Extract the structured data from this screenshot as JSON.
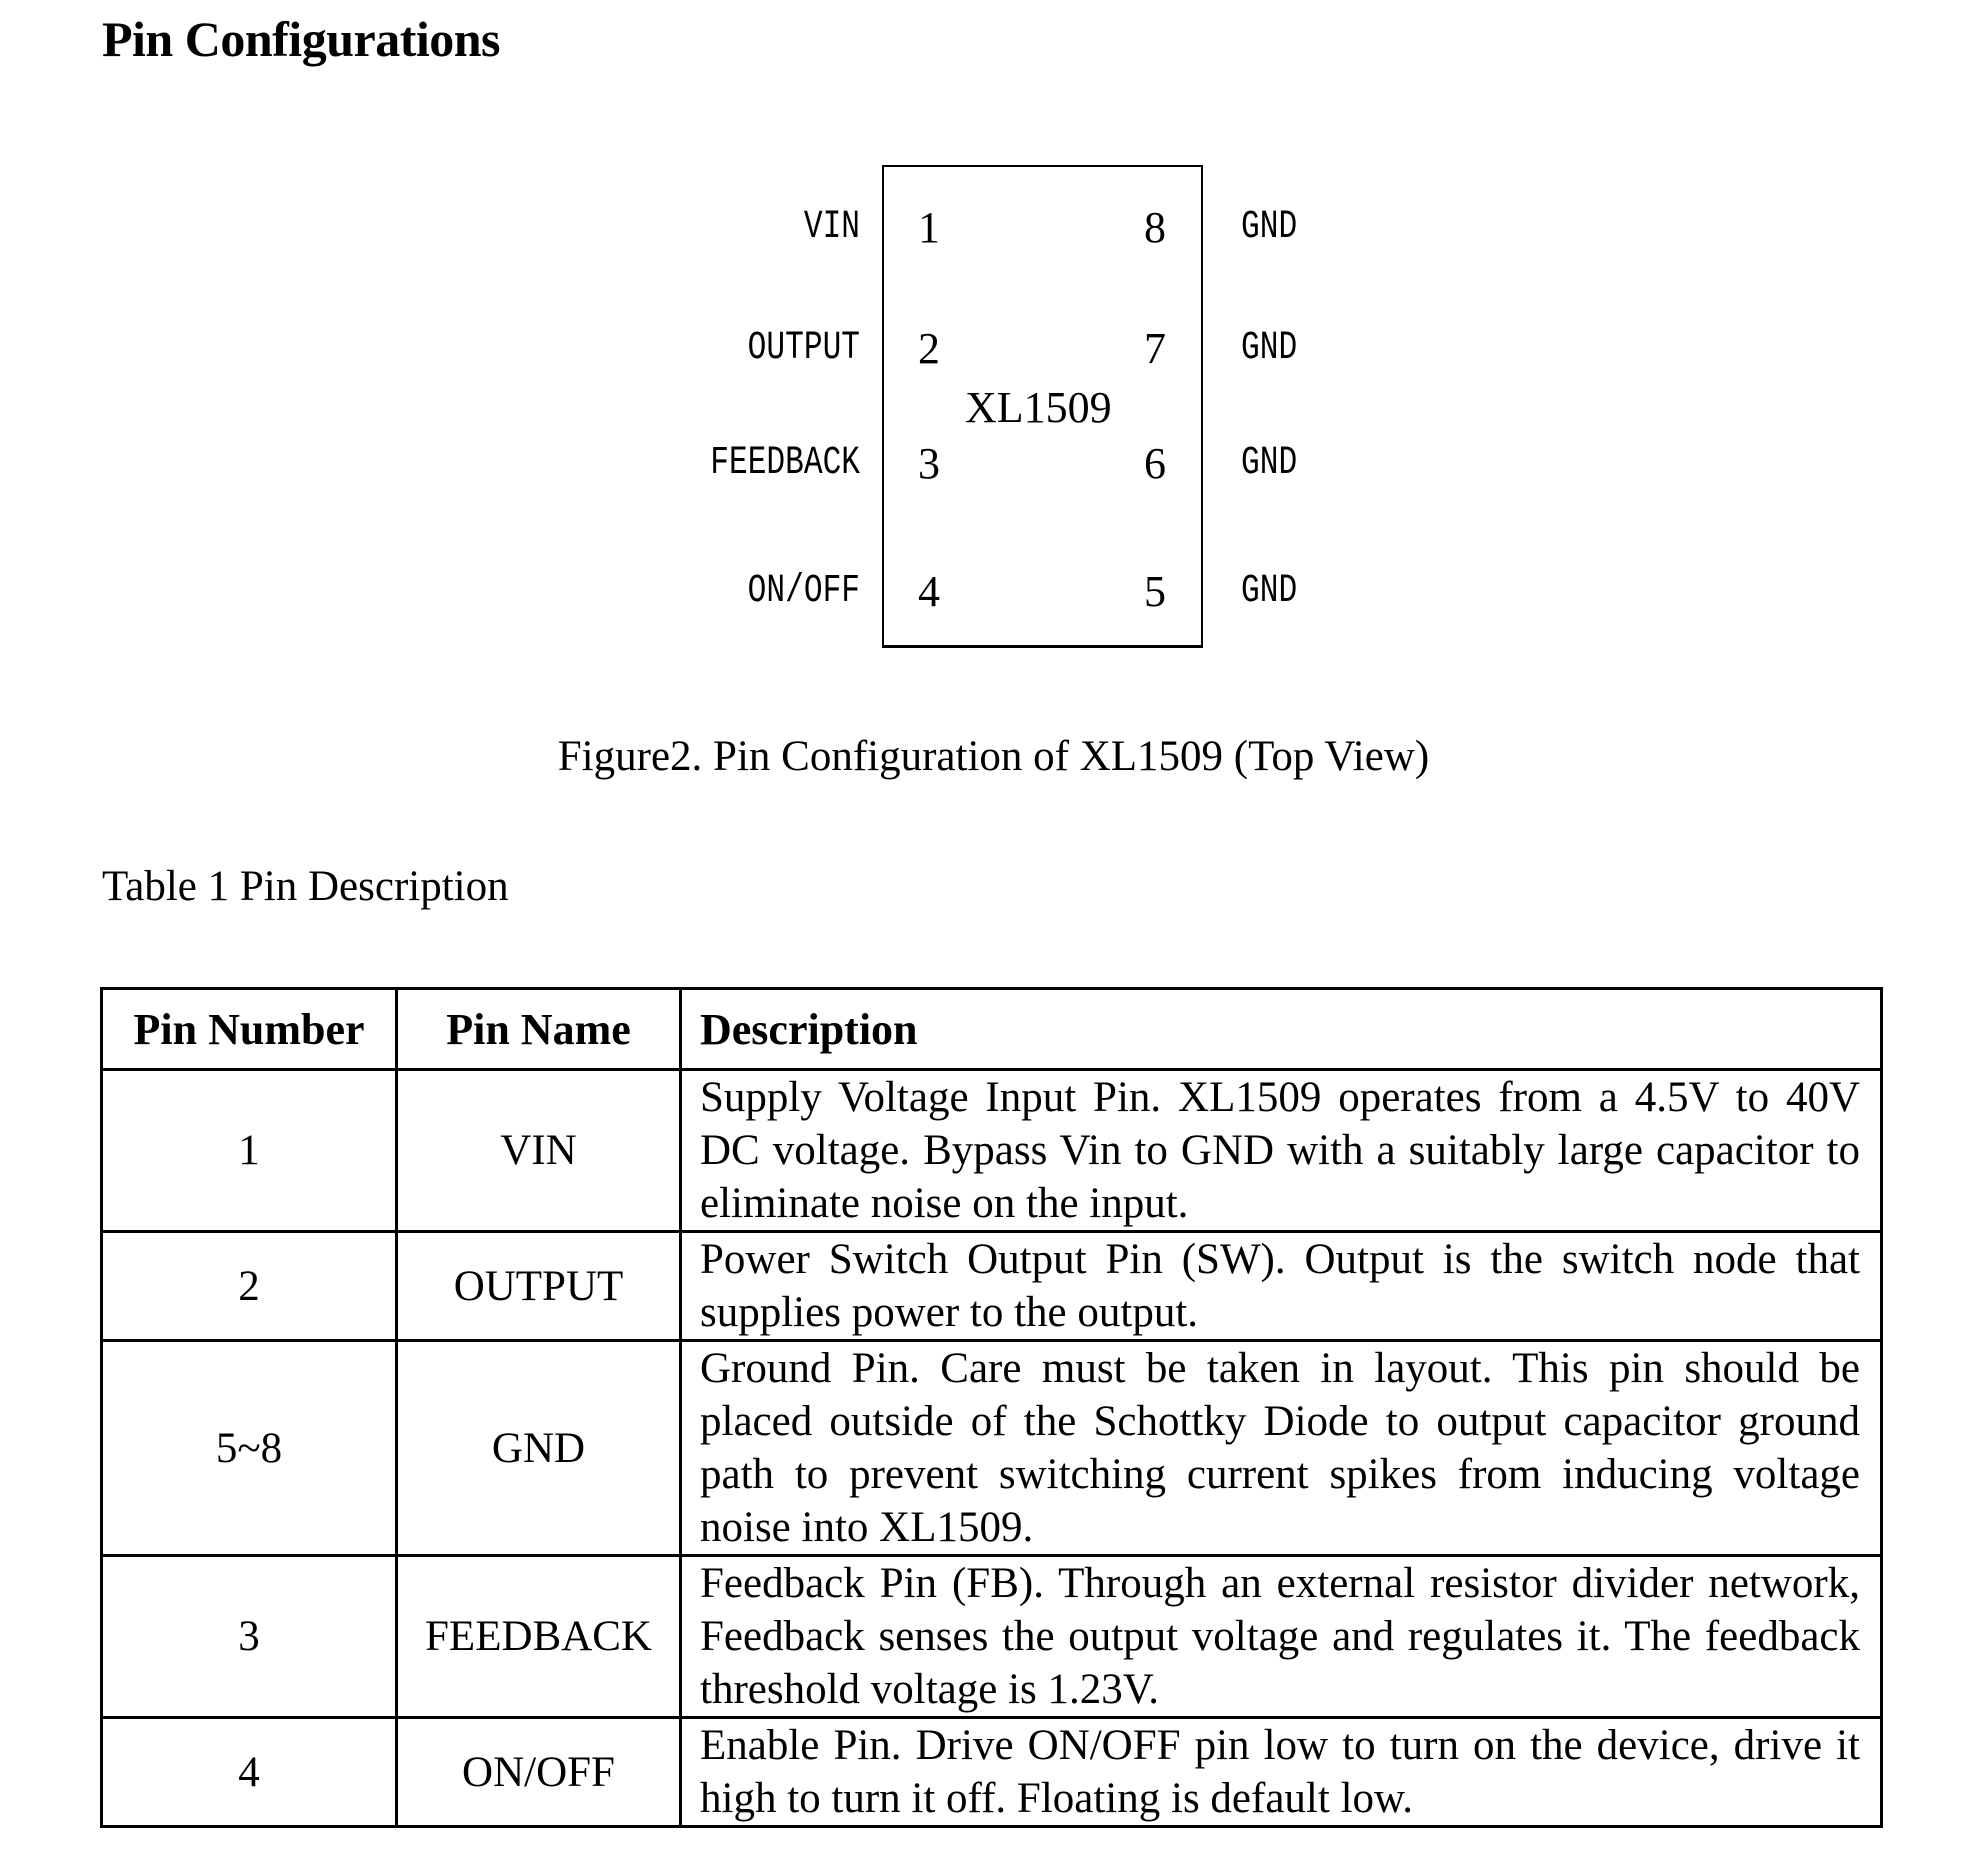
{
  "heading": "Pin Configurations",
  "figure": {
    "part_name": "XL1509",
    "left_pins": [
      {
        "number": "1",
        "name": "VIN"
      },
      {
        "number": "2",
        "name": "OUTPUT"
      },
      {
        "number": "3",
        "name": "FEEDBACK"
      },
      {
        "number": "4",
        "name": "ON/OFF"
      }
    ],
    "right_pins": [
      {
        "number": "8",
        "name": "GND"
      },
      {
        "number": "7",
        "name": "GND"
      },
      {
        "number": "6",
        "name": "GND"
      },
      {
        "number": "5",
        "name": "GND"
      }
    ],
    "caption": "Figure2. Pin Configuration of XL1509 (Top View)"
  },
  "table": {
    "title": "Table 1 Pin Description",
    "headers": [
      "Pin Number",
      "Pin Name",
      "Description"
    ],
    "rows": [
      {
        "number": "1",
        "name": "VIN",
        "description": "Supply Voltage Input Pin. XL1509 operates from a 4.5V to 40V DC voltage. Bypass Vin to GND with a suitably large capacitor to eliminate noise on the input."
      },
      {
        "number": "2",
        "name": "OUTPUT",
        "description": "Power Switch Output Pin (SW). Output is the switch node that supplies power to the output."
      },
      {
        "number": "5~8",
        "name": "GND",
        "description": "Ground Pin. Care must be taken in layout. This pin should be placed outside of the Schottky Diode to output capacitor ground path to prevent switching current spikes from inducing voltage noise into XL1509."
      },
      {
        "number": "3",
        "name": "FEEDBACK",
        "description": "Feedback Pin (FB). Through an external resistor divider network, Feedback senses the output voltage and regulates it. The feedback threshold voltage is 1.23V."
      },
      {
        "number": "4",
        "name": "ON/OFF",
        "description": "Enable Pin. Drive ON/OFF pin low to turn on the device, drive it high to turn it off. Floating is default low."
      }
    ]
  }
}
